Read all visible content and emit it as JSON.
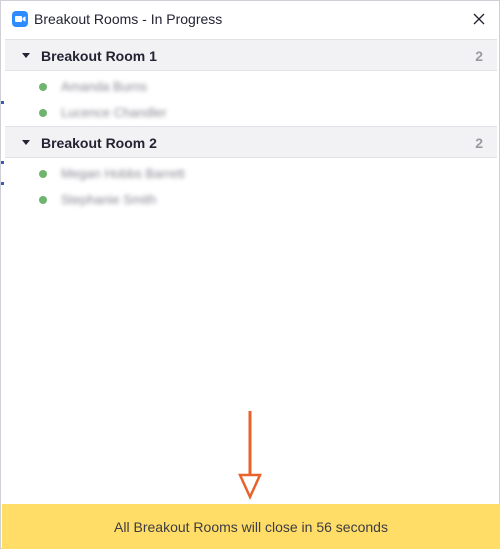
{
  "window": {
    "title": "Breakout Rooms - In Progress",
    "app_icon": "video-camera-icon",
    "close_icon": "close-icon"
  },
  "rooms": [
    {
      "name": "Breakout Room 1",
      "count": "2",
      "participants": [
        {
          "name": "Amanda Burns"
        },
        {
          "name": "Lucence Chandler"
        }
      ]
    },
    {
      "name": "Breakout Room 2",
      "count": "2",
      "participants": [
        {
          "name": "Megan Hobbs Barrett"
        },
        {
          "name": "Stephanie Smith"
        }
      ]
    }
  ],
  "banner": {
    "text": "All Breakout Rooms will close in 56 seconds"
  },
  "colors": {
    "accent": "#2d8cff",
    "banner": "#ffdd66",
    "status_dot": "#6fb46f",
    "annotation_arrow": "#e8632b"
  }
}
